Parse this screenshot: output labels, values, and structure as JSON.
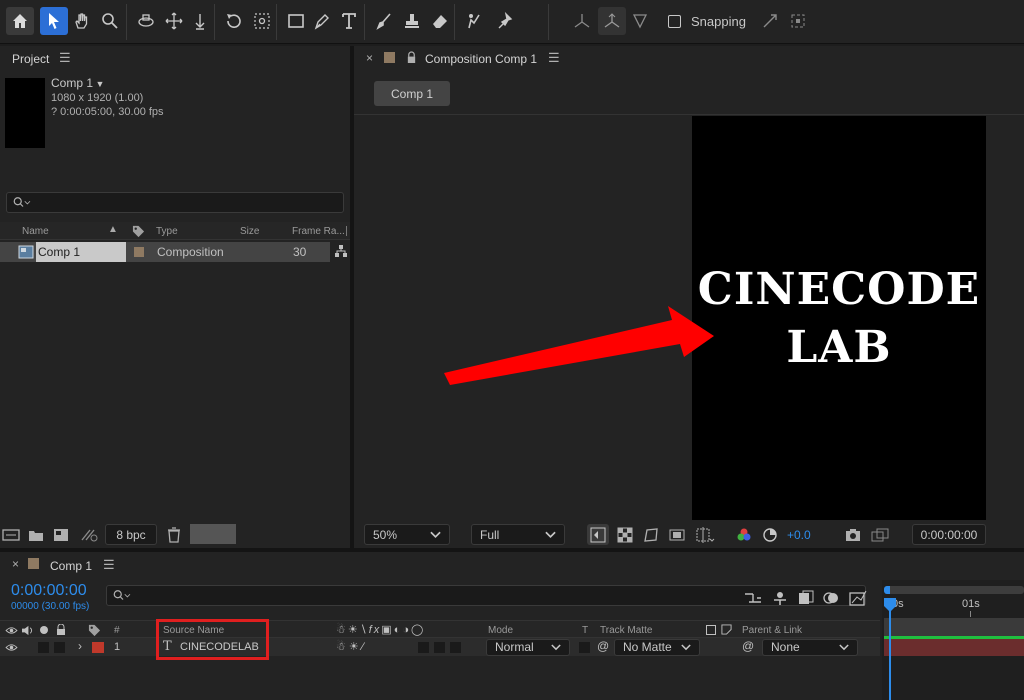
{
  "toolbar": {
    "snapping_label": "Snapping"
  },
  "project": {
    "title": "Project",
    "comp_name": "Comp 1",
    "comp_dims": "1080 x 1920 (1.00)",
    "comp_duration": "? 0:00:05:00, 30.00 fps",
    "columns": {
      "name": "Name",
      "type": "Type",
      "size": "Size",
      "frame_rate": "Frame Ra..."
    },
    "rows": [
      {
        "name": "Comp 1",
        "type": "Composition",
        "frame_rate": "30",
        "label_color": "#8f7a62"
      }
    ],
    "bpc": "8 bpc"
  },
  "viewer": {
    "tab_title": "Composition Comp 1",
    "comp_tab": "Comp 1",
    "canvas_text_line1": "CINECODE",
    "canvas_text_line2": "LAB",
    "zoom": "50%",
    "resolution": "Full",
    "exposure": "+0.0",
    "timecode": "0:00:00:00",
    "arrow_color": "#ff0000"
  },
  "timeline": {
    "comp_tab": "Comp 1",
    "timecode": "0:00:00:00",
    "frame_info": "00000 (30.00 fps)",
    "columns": {
      "number": "#",
      "source_name": "Source Name",
      "mode": "Mode",
      "t": "T",
      "track_matte": "Track Matte",
      "parent_link": "Parent & Link"
    },
    "ruler": {
      "start": "0s",
      "mark": "01s"
    },
    "layers": [
      {
        "index": "1",
        "name": "CINECODELAB",
        "mode": "Normal",
        "track_matte": "No Matte",
        "parent": "None",
        "label_color": "#c0392b"
      }
    ],
    "accent_color": "#2d8ceb",
    "highlight_color": "#e01f1f"
  }
}
